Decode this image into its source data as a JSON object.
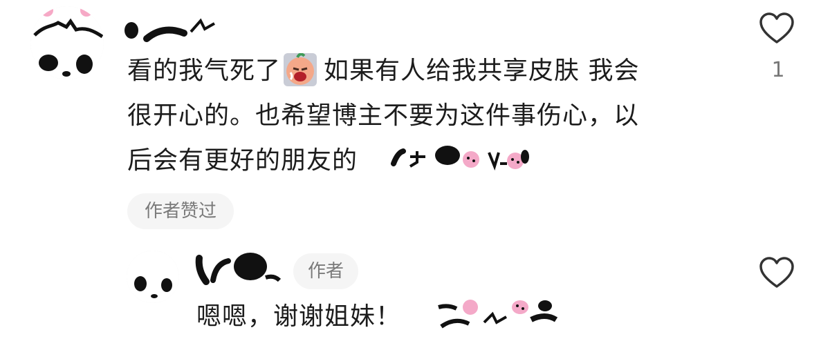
{
  "comment": {
    "text_line1_before_emoji": "看的我气死了",
    "text_line1_after_emoji": "如果有人给我共享皮肤 我会",
    "text_line2": "很开心的。也希望博主不要为这件事伤心，以",
    "text_line3": "后会有更好的朋友的",
    "liked_by_author_label": "作者赞过",
    "like_count": "1",
    "emoji_icon": "crying-face-emoji-icon",
    "sticker_icon": "panda-sticker-icon"
  },
  "reply": {
    "author_badge": "作者",
    "text": "嗯嗯，谢谢姐妹！",
    "sticker_icon": "panda-sticker-icon"
  },
  "colors": {
    "text": "#1c1c1c",
    "muted": "#7a7a7a",
    "pill_bg": "#f5f5f5",
    "heart_outline": "#333333",
    "sticker_pink": "#f4a9c8"
  }
}
